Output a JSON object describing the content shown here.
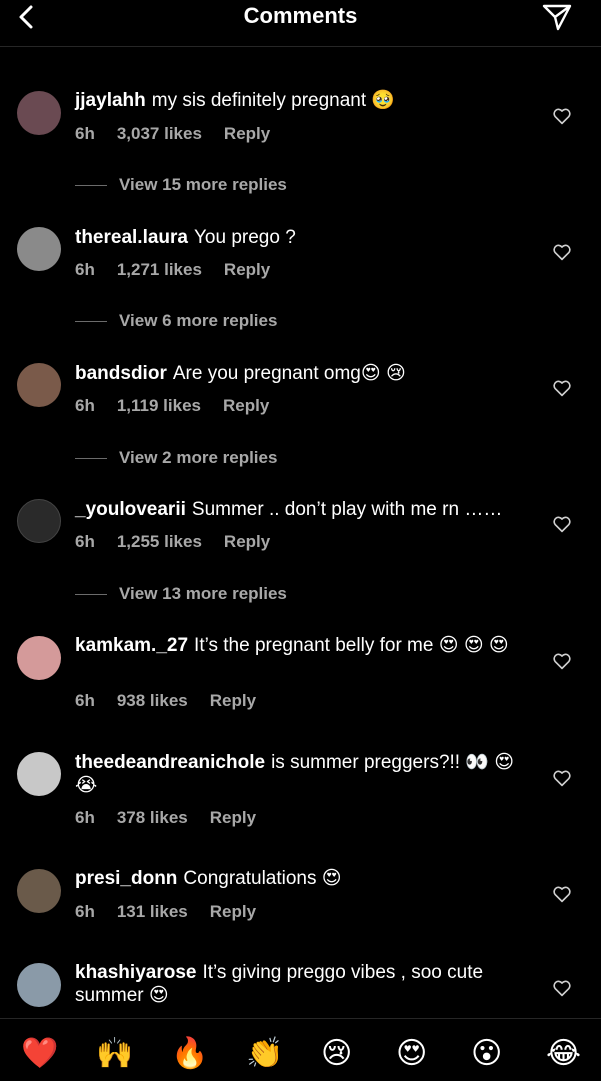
{
  "header": {
    "title": "Comments",
    "back_icon": "back-chevron-icon",
    "send_icon": "paper-plane-icon"
  },
  "comments": [
    {
      "username": "jjaylahh",
      "text": "my sis definitely pregnant",
      "emoji": "🥹",
      "time": "6h",
      "likes": "3,037 likes",
      "reply": "Reply",
      "view_more": "View 15 more replies",
      "avatar_color": "#6a4a52"
    },
    {
      "username": "thereal.laura",
      "text": "You prego ?",
      "emoji": "",
      "time": "6h",
      "likes": "1,271 likes",
      "reply": "Reply",
      "view_more": "View 6 more replies",
      "avatar_color": "#8a8a8a"
    },
    {
      "username": "bandsdior",
      "text": "Are you pregnant omg",
      "emoji": "😍 😢",
      "time": "6h",
      "likes": "1,119 likes",
      "reply": "Reply",
      "view_more": "View 2 more replies",
      "avatar_color": "#7a5a4a"
    },
    {
      "username": "_youlovearii",
      "text": "Summer .. don’t play with me rn ……",
      "emoji": "",
      "time": "6h",
      "likes": "1,255 likes",
      "reply": "Reply",
      "view_more": "View 13 more replies",
      "avatar_color": "#2a2a2a"
    },
    {
      "username": "kamkam._27",
      "text": "It’s the pregnant belly for me",
      "emoji": "😍 😍 😍",
      "time": "6h",
      "likes": "938 likes",
      "reply": "Reply",
      "view_more": "",
      "avatar_color": "#d49a9a"
    },
    {
      "username": "theedeandreanichole",
      "text": "is summer preggers?!!",
      "emoji": "👀 😍 😭",
      "time": "6h",
      "likes": "378 likes",
      "reply": "Reply",
      "view_more": "",
      "avatar_color": "#c8c8c8"
    },
    {
      "username": "presi_donn",
      "text": "Congratulations",
      "emoji": "😍",
      "time": "6h",
      "likes": "131 likes",
      "reply": "Reply",
      "view_more": "",
      "avatar_color": "#6a5a4a"
    },
    {
      "username": "khashiyarose",
      "text": "It’s giving preggo vibes , soo cute summer",
      "emoji": "😍",
      "time": "",
      "likes": "",
      "reply": "",
      "view_more": "",
      "avatar_color": "#8a9aa8"
    }
  ],
  "emoji_bar": [
    "❤️",
    "🙌",
    "🔥",
    "👏",
    "😢",
    "😍",
    "😮",
    "😂"
  ]
}
